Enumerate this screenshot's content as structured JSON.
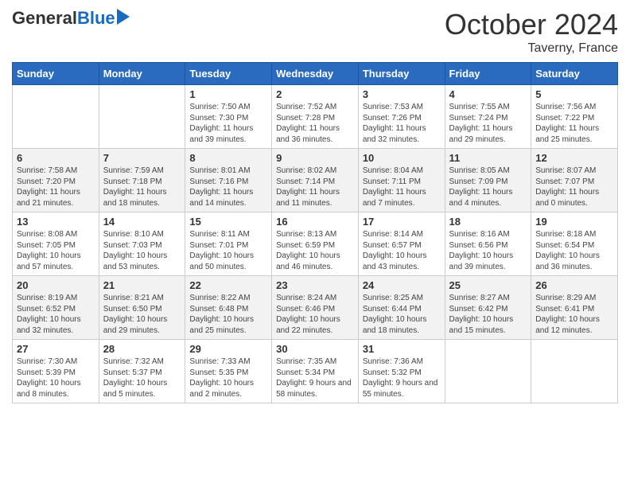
{
  "header": {
    "logo_general": "General",
    "logo_blue": "Blue",
    "month": "October 2024",
    "location": "Taverny, France"
  },
  "days_of_week": [
    "Sunday",
    "Monday",
    "Tuesday",
    "Wednesday",
    "Thursday",
    "Friday",
    "Saturday"
  ],
  "weeks": [
    [
      {
        "day": "",
        "info": ""
      },
      {
        "day": "",
        "info": ""
      },
      {
        "day": "1",
        "info": "Sunrise: 7:50 AM\nSunset: 7:30 PM\nDaylight: 11 hours and 39 minutes."
      },
      {
        "day": "2",
        "info": "Sunrise: 7:52 AM\nSunset: 7:28 PM\nDaylight: 11 hours and 36 minutes."
      },
      {
        "day": "3",
        "info": "Sunrise: 7:53 AM\nSunset: 7:26 PM\nDaylight: 11 hours and 32 minutes."
      },
      {
        "day": "4",
        "info": "Sunrise: 7:55 AM\nSunset: 7:24 PM\nDaylight: 11 hours and 29 minutes."
      },
      {
        "day": "5",
        "info": "Sunrise: 7:56 AM\nSunset: 7:22 PM\nDaylight: 11 hours and 25 minutes."
      }
    ],
    [
      {
        "day": "6",
        "info": "Sunrise: 7:58 AM\nSunset: 7:20 PM\nDaylight: 11 hours and 21 minutes."
      },
      {
        "day": "7",
        "info": "Sunrise: 7:59 AM\nSunset: 7:18 PM\nDaylight: 11 hours and 18 minutes."
      },
      {
        "day": "8",
        "info": "Sunrise: 8:01 AM\nSunset: 7:16 PM\nDaylight: 11 hours and 14 minutes."
      },
      {
        "day": "9",
        "info": "Sunrise: 8:02 AM\nSunset: 7:14 PM\nDaylight: 11 hours and 11 minutes."
      },
      {
        "day": "10",
        "info": "Sunrise: 8:04 AM\nSunset: 7:11 PM\nDaylight: 11 hours and 7 minutes."
      },
      {
        "day": "11",
        "info": "Sunrise: 8:05 AM\nSunset: 7:09 PM\nDaylight: 11 hours and 4 minutes."
      },
      {
        "day": "12",
        "info": "Sunrise: 8:07 AM\nSunset: 7:07 PM\nDaylight: 11 hours and 0 minutes."
      }
    ],
    [
      {
        "day": "13",
        "info": "Sunrise: 8:08 AM\nSunset: 7:05 PM\nDaylight: 10 hours and 57 minutes."
      },
      {
        "day": "14",
        "info": "Sunrise: 8:10 AM\nSunset: 7:03 PM\nDaylight: 10 hours and 53 minutes."
      },
      {
        "day": "15",
        "info": "Sunrise: 8:11 AM\nSunset: 7:01 PM\nDaylight: 10 hours and 50 minutes."
      },
      {
        "day": "16",
        "info": "Sunrise: 8:13 AM\nSunset: 6:59 PM\nDaylight: 10 hours and 46 minutes."
      },
      {
        "day": "17",
        "info": "Sunrise: 8:14 AM\nSunset: 6:57 PM\nDaylight: 10 hours and 43 minutes."
      },
      {
        "day": "18",
        "info": "Sunrise: 8:16 AM\nSunset: 6:56 PM\nDaylight: 10 hours and 39 minutes."
      },
      {
        "day": "19",
        "info": "Sunrise: 8:18 AM\nSunset: 6:54 PM\nDaylight: 10 hours and 36 minutes."
      }
    ],
    [
      {
        "day": "20",
        "info": "Sunrise: 8:19 AM\nSunset: 6:52 PM\nDaylight: 10 hours and 32 minutes."
      },
      {
        "day": "21",
        "info": "Sunrise: 8:21 AM\nSunset: 6:50 PM\nDaylight: 10 hours and 29 minutes."
      },
      {
        "day": "22",
        "info": "Sunrise: 8:22 AM\nSunset: 6:48 PM\nDaylight: 10 hours and 25 minutes."
      },
      {
        "day": "23",
        "info": "Sunrise: 8:24 AM\nSunset: 6:46 PM\nDaylight: 10 hours and 22 minutes."
      },
      {
        "day": "24",
        "info": "Sunrise: 8:25 AM\nSunset: 6:44 PM\nDaylight: 10 hours and 18 minutes."
      },
      {
        "day": "25",
        "info": "Sunrise: 8:27 AM\nSunset: 6:42 PM\nDaylight: 10 hours and 15 minutes."
      },
      {
        "day": "26",
        "info": "Sunrise: 8:29 AM\nSunset: 6:41 PM\nDaylight: 10 hours and 12 minutes."
      }
    ],
    [
      {
        "day": "27",
        "info": "Sunrise: 7:30 AM\nSunset: 5:39 PM\nDaylight: 10 hours and 8 minutes."
      },
      {
        "day": "28",
        "info": "Sunrise: 7:32 AM\nSunset: 5:37 PM\nDaylight: 10 hours and 5 minutes."
      },
      {
        "day": "29",
        "info": "Sunrise: 7:33 AM\nSunset: 5:35 PM\nDaylight: 10 hours and 2 minutes."
      },
      {
        "day": "30",
        "info": "Sunrise: 7:35 AM\nSunset: 5:34 PM\nDaylight: 9 hours and 58 minutes."
      },
      {
        "day": "31",
        "info": "Sunrise: 7:36 AM\nSunset: 5:32 PM\nDaylight: 9 hours and 55 minutes."
      },
      {
        "day": "",
        "info": ""
      },
      {
        "day": "",
        "info": ""
      }
    ]
  ]
}
